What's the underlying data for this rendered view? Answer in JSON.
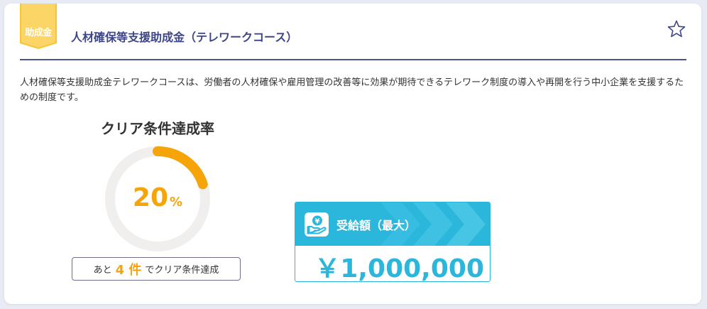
{
  "badge": {
    "label": "助成金"
  },
  "header": {
    "title": "人材確保等支援助成金（テレワークコース）"
  },
  "description": "人材確保等支援助成金テレワークコースは、労働者の人材確保や雇用管理の改善等に効果が期待できるテレワーク制度の導入や再開を行う中小企業を支援するための制度です。",
  "progress": {
    "title": "クリア条件達成率",
    "value": 20,
    "percent_text": "20",
    "unit": "%",
    "remaining_prefix": "あと",
    "remaining_count": "4",
    "remaining_unit": "件",
    "remaining_suffix": "でクリア条件達成"
  },
  "amount": {
    "label": "受給額（最大）",
    "value": "￥1,000,000"
  },
  "icons": {
    "favorite": "star-outline-icon",
    "amount": "yen-hand-icon"
  },
  "colors": {
    "accent_orange": "#f5a40a",
    "accent_blue": "#2bb6dc",
    "title_navy": "#3d4689",
    "badge_yellow": "#f7c533"
  }
}
